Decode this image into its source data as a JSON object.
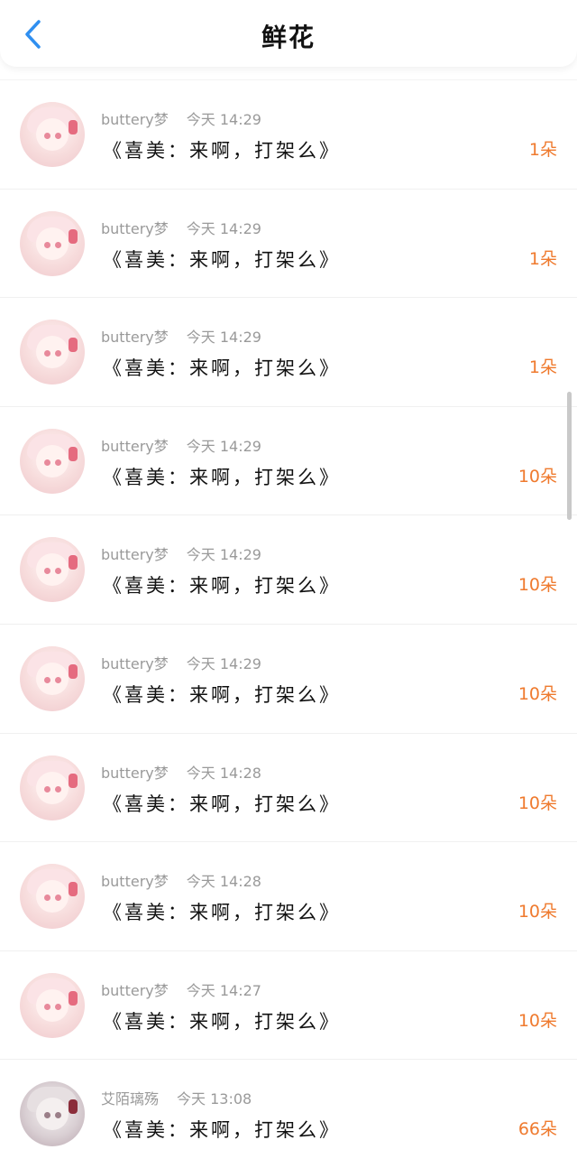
{
  "header": {
    "title": "鲜花",
    "back_icon": "chevron-left-icon",
    "accent_color": "#2f8ff0"
  },
  "colors": {
    "count": "#ef7a2e",
    "meta": "#9a9a9a",
    "message": "#111111"
  },
  "items": [
    {
      "user": "buttery梦",
      "time": "今天 14:29",
      "message": "《喜美：来啊，打架么》",
      "count": "1朵"
    },
    {
      "user": "buttery梦",
      "time": "今天 14:29",
      "message": "《喜美：来啊，打架么》",
      "count": "1朵"
    },
    {
      "user": "buttery梦",
      "time": "今天 14:29",
      "message": "《喜美：来啊，打架么》",
      "count": "1朵"
    },
    {
      "user": "buttery梦",
      "time": "今天 14:29",
      "message": "《喜美：来啊，打架么》",
      "count": "10朵"
    },
    {
      "user": "buttery梦",
      "time": "今天 14:29",
      "message": "《喜美：来啊，打架么》",
      "count": "10朵"
    },
    {
      "user": "buttery梦",
      "time": "今天 14:29",
      "message": "《喜美：来啊，打架么》",
      "count": "10朵"
    },
    {
      "user": "buttery梦",
      "time": "今天 14:28",
      "message": "《喜美：来啊，打架么》",
      "count": "10朵"
    },
    {
      "user": "buttery梦",
      "time": "今天 14:28",
      "message": "《喜美：来啊，打架么》",
      "count": "10朵"
    },
    {
      "user": "buttery梦",
      "time": "今天 14:27",
      "message": "《喜美：来啊，打架么》",
      "count": "10朵"
    },
    {
      "user": "艾陌璃殇",
      "time": "今天 13:08",
      "message": "《喜美：来啊，打架么》",
      "count": "66朵"
    }
  ]
}
